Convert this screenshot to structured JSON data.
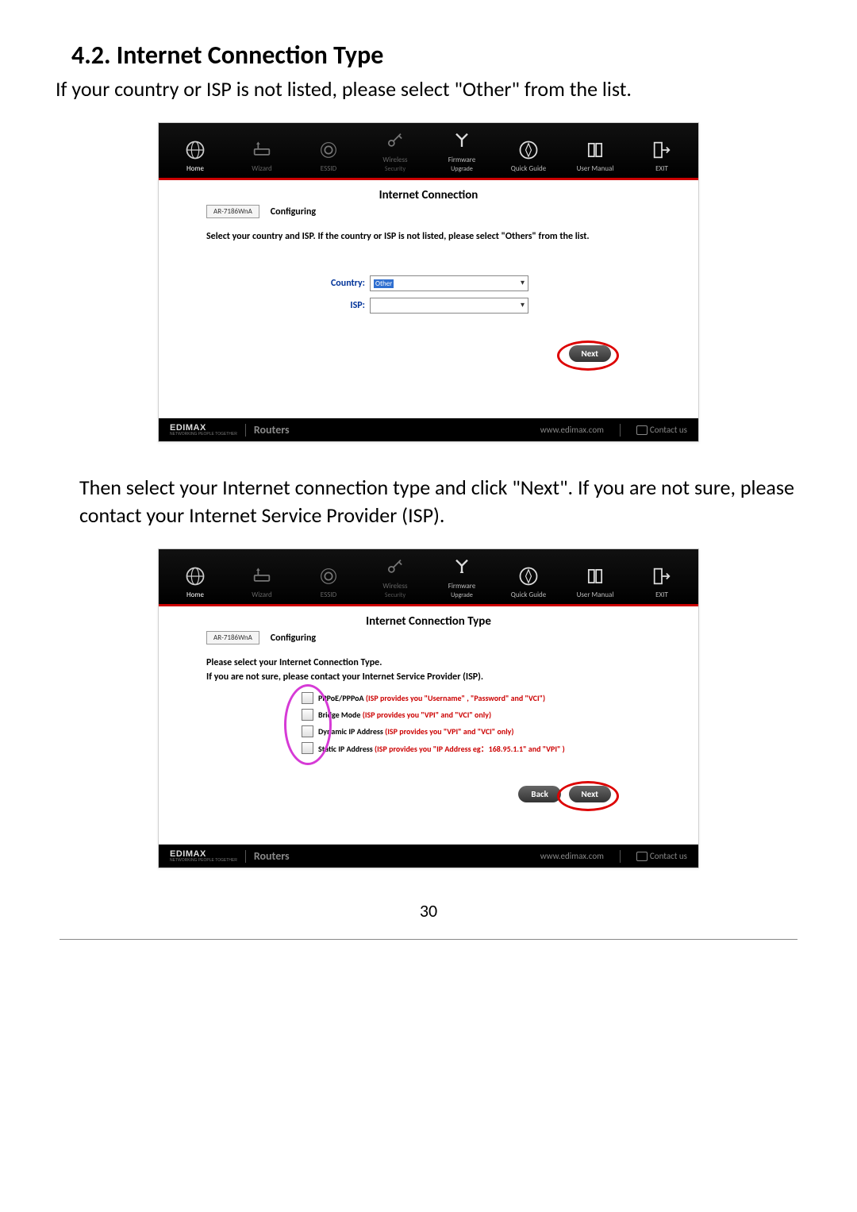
{
  "page": {
    "heading": "4.2. Internet Connection Type",
    "intro": "If your country or ISP is not listed, please select \"Other\" from the list.",
    "middle_text": "Then select your Internet connection type and click \"Next\".  If you are not sure, please contact your Internet Service Provider (ISP).",
    "page_number": "30"
  },
  "nav": {
    "home": "Home",
    "wizard": "Wizard",
    "essid": "ESSID",
    "wireless": "Wireless",
    "security": "Security",
    "firmware": "Firmware",
    "upgrade": "Upgrade",
    "quick_guide": "Quick Guide",
    "user_manual": "User Manual",
    "exit": "EXIT"
  },
  "screenshot1": {
    "title": "Internet Connection",
    "model": "AR-7186WnA",
    "configuring": "Configuring",
    "instruction": "Select your country and ISP. If the country or ISP is not listed, please select \"Others\" from the list.",
    "country_label": "Country:",
    "country_value": "Other",
    "isp_label": "ISP:",
    "isp_value": "",
    "next": "Next"
  },
  "screenshot2": {
    "title": "Internet Connection Type",
    "model": "AR-7186WnA",
    "configuring": "Configuring",
    "instruction1": "Please select your Internet Connection Type.",
    "instruction2": "If you are not sure, please contact your Internet Service Provider (ISP).",
    "options": [
      {
        "main": "PPPoE/PPPoA",
        "note": "(ISP provides you \"Username\" , \"Password\" and \"VCI\")"
      },
      {
        "main": "Bridge Mode",
        "note": "(ISP provides you \"VPI\" and \"VCI\" only)"
      },
      {
        "main": "Dynamic IP Address",
        "note": "(ISP provides you \"VPI\" and \"VCI\" only)"
      },
      {
        "main": "Static IP Address",
        "note": "(ISP provides you \"IP Address eg：168.95.1.1\" and \"VPI\" )"
      }
    ],
    "back": "Back",
    "next": "Next"
  },
  "footer": {
    "brand": "EDIMAX",
    "brand_tag": "NETWORKING PEOPLE TOGETHER",
    "routers": "Routers",
    "url": "www.edimax.com",
    "contact": "Contact us"
  }
}
